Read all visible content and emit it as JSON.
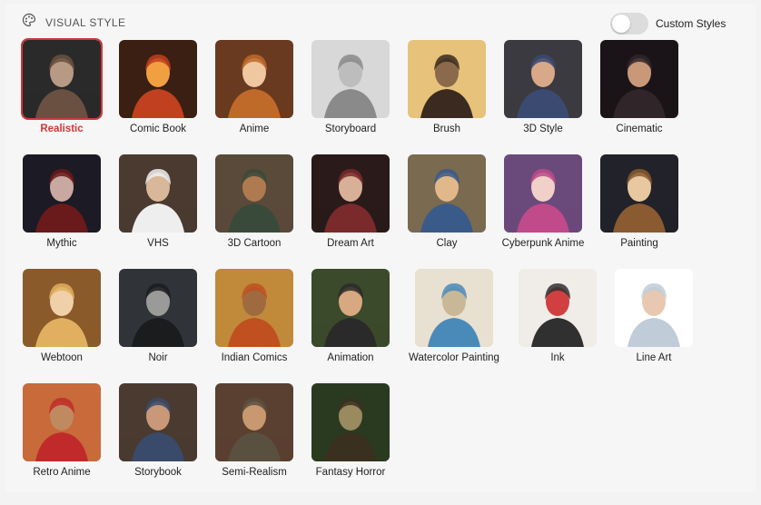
{
  "header": {
    "title": "VISUAL STYLE",
    "icon": "palette-icon"
  },
  "custom_styles": {
    "label": "Custom Styles",
    "enabled": false
  },
  "selected": "Realistic",
  "styles": [
    {
      "label": "Realistic",
      "bg": "#2a2a2a",
      "fg": "#6a5040",
      "skin": "#b89a84",
      "selected": true
    },
    {
      "label": "Comic Book",
      "bg": "#3a1f12",
      "fg": "#c04020",
      "skin": "#f0a040"
    },
    {
      "label": "Anime",
      "bg": "#6a3a20",
      "fg": "#c06a2a",
      "skin": "#f0c8a0"
    },
    {
      "label": "Storyboard",
      "bg": "#d8d8d8",
      "fg": "#8a8a8a",
      "skin": "#bdbdbd"
    },
    {
      "label": "Brush",
      "bg": "#e6c27a",
      "fg": "#3a2a20",
      "skin": "#8a6a4a"
    },
    {
      "label": "3D Style",
      "bg": "#3a3a40",
      "fg": "#3b4a70",
      "skin": "#d8a888"
    },
    {
      "label": "Cinematic",
      "bg": "#1a1418",
      "fg": "#30262a",
      "skin": "#c89878"
    },
    {
      "label": "Mythic",
      "bg": "#1c1a24",
      "fg": "#6a1a1a",
      "skin": "#c8a8a0"
    },
    {
      "label": "VHS",
      "bg": "#4a3a30",
      "fg": "#eeeeee",
      "skin": "#d8b898"
    },
    {
      "label": "3D Cartoon",
      "bg": "#5a4a3a",
      "fg": "#3a4a3a",
      "skin": "#b07a50"
    },
    {
      "label": "Dream Art",
      "bg": "#2a1a1a",
      "fg": "#7a2a2a",
      "skin": "#d8b098"
    },
    {
      "label": "Clay",
      "bg": "#7a6a50",
      "fg": "#3a5a8a",
      "skin": "#e0b88a"
    },
    {
      "label": "Cyberpunk Anime",
      "bg": "#6a4a7a",
      "fg": "#c04a8a",
      "skin": "#f0d0c8"
    },
    {
      "label": "Painting",
      "bg": "#22222a",
      "fg": "#8a5a30",
      "skin": "#e8c8a0"
    },
    {
      "label": "Webtoon",
      "bg": "#8a5a2a",
      "fg": "#e0b060",
      "skin": "#f0d0a8"
    },
    {
      "label": "Noir",
      "bg": "#303438",
      "fg": "#1a1c1e",
      "skin": "#9a9a98"
    },
    {
      "label": "Indian Comics",
      "bg": "#c08a3a",
      "fg": "#c05020",
      "skin": "#a06a40"
    },
    {
      "label": "Animation",
      "bg": "#3a4a2a",
      "fg": "#2a2a2a",
      "skin": "#d8a880"
    },
    {
      "label": "Watercolor Painting",
      "bg": "#e8e0d0",
      "fg": "#4a8ab8",
      "skin": "#c8b898"
    },
    {
      "label": "Ink",
      "bg": "#f0ece8",
      "fg": "#303030",
      "skin": "#d04040"
    },
    {
      "label": "Line Art",
      "bg": "#ffffff",
      "fg": "#c0ccd8",
      "skin": "#e8c8b0"
    },
    {
      "label": "Retro Anime",
      "bg": "#c86a3a",
      "fg": "#c02a2a",
      "skin": "#c08a60"
    },
    {
      "label": "Storybook",
      "bg": "#4a3a30",
      "fg": "#3a4a6a",
      "skin": "#c89878"
    },
    {
      "label": "Semi-Realism",
      "bg": "#5a4030",
      "fg": "#5a5040",
      "skin": "#c89870"
    },
    {
      "label": "Fantasy Horror",
      "bg": "#2a3a20",
      "fg": "#3a3020",
      "skin": "#9a8a60"
    }
  ]
}
